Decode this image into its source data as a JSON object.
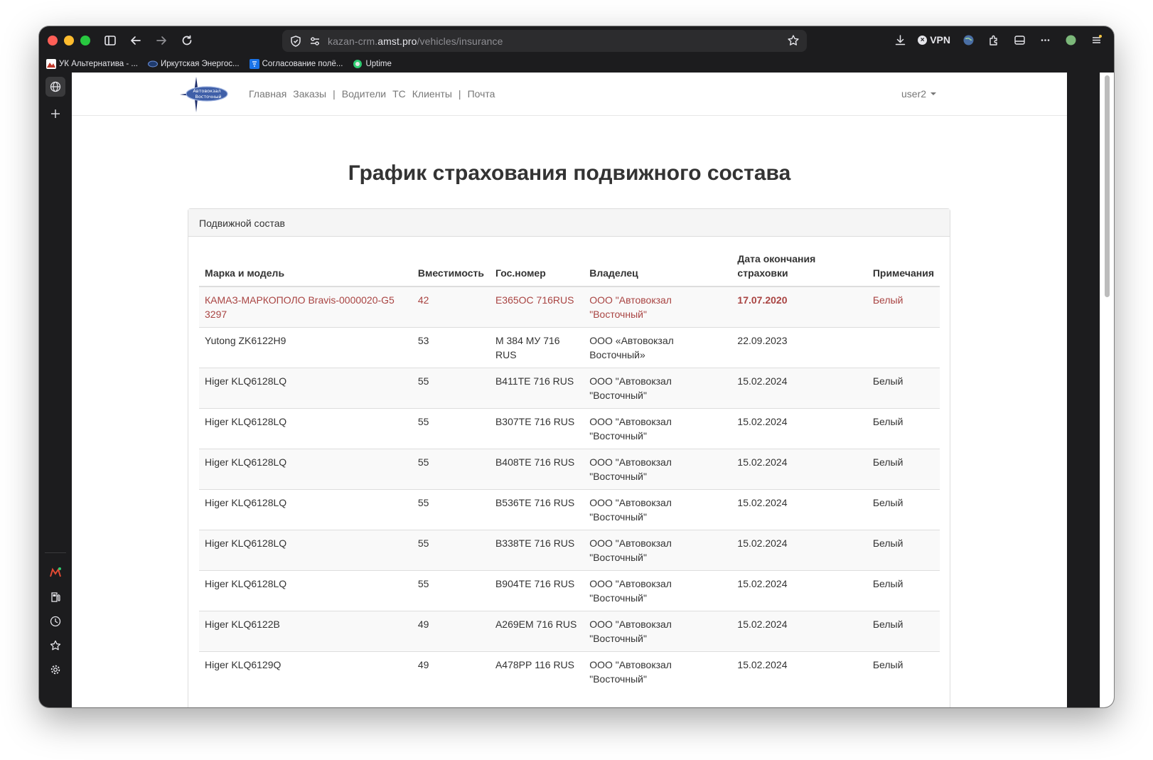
{
  "browser": {
    "url_prefix": "kazan-crm.",
    "url_host": "amst.pro",
    "url_path": "/vehicles/insurance",
    "vpn_label": "VPN",
    "bookmarks": [
      {
        "label": "УК Альтернатива - ...",
        "icon": "mountain-logo-icon"
      },
      {
        "label": "Иркутская Энергос...",
        "icon": "energy-logo-icon"
      },
      {
        "label": "Согласование полё...",
        "icon": "shield-logo-icon"
      },
      {
        "label": "Uptime",
        "icon": "uptime-logo-icon"
      }
    ]
  },
  "site": {
    "logo_text_top": "Автовокзал",
    "logo_text_bottom": "Восточный",
    "menu": {
      "home": "Главная",
      "orders": "Заказы",
      "sep1": "|",
      "drivers": "Водители",
      "vehicles": "ТС",
      "clients": "Клиенты",
      "sep2": "|",
      "mail": "Почта"
    },
    "user": "user2"
  },
  "page": {
    "title": "График страхования подвижного состава",
    "panel_title": "Подвижной состав"
  },
  "table": {
    "headers": [
      "Марка и модель",
      "Вместимость",
      "Гос.номер",
      "Владелец",
      "Дата окончания страховки",
      "Примечания"
    ],
    "rows": [
      {
        "model": "КАМАЗ-МАРКОПОЛО Bravis-0000020-G5 3297",
        "capacity": "42",
        "plate": "Е365ОС 716RUS",
        "owner": "ООО \"Автовокзал \"Восточный\"",
        "date": "17.07.2020",
        "note": "Белый",
        "status": "expired"
      },
      {
        "model": "Yutong ZK6122H9",
        "capacity": "53",
        "plate": "М 384 МУ 716 RUS",
        "owner": "ООО «Автовокзал Восточный»",
        "date": "22.09.2023",
        "note": "",
        "status": "ok"
      },
      {
        "model": "Higer KLQ6128LQ",
        "capacity": "55",
        "plate": "В411ТЕ 716 RUS",
        "owner": "ООО \"Автовокзал \"Восточный\"",
        "date": "15.02.2024",
        "note": "Белый",
        "status": "ok"
      },
      {
        "model": "Higer KLQ6128LQ",
        "capacity": "55",
        "plate": "В307ТЕ 716 RUS",
        "owner": "ООО \"Автовокзал \"Восточный\"",
        "date": "15.02.2024",
        "note": "Белый",
        "status": "ok"
      },
      {
        "model": "Higer KLQ6128LQ",
        "capacity": "55",
        "plate": "В408ТЕ 716 RUS",
        "owner": "ООО \"Автовокзал \"Восточный\"",
        "date": "15.02.2024",
        "note": "Белый",
        "status": "ok"
      },
      {
        "model": "Higer KLQ6128LQ",
        "capacity": "55",
        "plate": "В536ТЕ 716 RUS",
        "owner": "ООО \"Автовокзал \"Восточный\"",
        "date": "15.02.2024",
        "note": "Белый",
        "status": "ok"
      },
      {
        "model": "Higer KLQ6128LQ",
        "capacity": "55",
        "plate": "В338ТЕ 716 RUS",
        "owner": "ООО \"Автовокзал \"Восточный\"",
        "date": "15.02.2024",
        "note": "Белый",
        "status": "ok"
      },
      {
        "model": "Higer KLQ6128LQ",
        "capacity": "55",
        "plate": "В904ТЕ 716 RUS",
        "owner": "ООО \"Автовокзал \"Восточный\"",
        "date": "15.02.2024",
        "note": "Белый",
        "status": "ok"
      },
      {
        "model": "Higer KLQ6122B",
        "capacity": "49",
        "plate": "А269ЕМ 716 RUS",
        "owner": "ООО \"Автовокзал \"Восточный\"",
        "date": "15.02.2024",
        "note": "Белый",
        "status": "ok"
      },
      {
        "model": "Higer KLQ6129Q",
        "capacity": "49",
        "plate": "А478РР 116 RUS",
        "owner": "ООО \"Автовокзал \"Восточный\"",
        "date": "15.02.2024",
        "note": "Белый",
        "status": "ok"
      }
    ]
  },
  "colors": {
    "expired_text": "#a94442",
    "link_gray": "#777777",
    "panel_head_bg": "#f5f5f5"
  }
}
